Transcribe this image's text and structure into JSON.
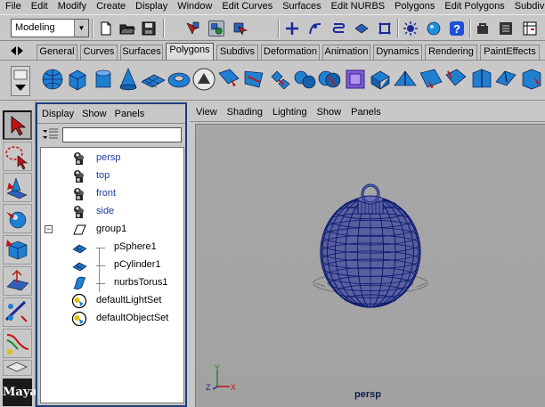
{
  "menubar": [
    "File",
    "Edit",
    "Modify",
    "Create",
    "Display",
    "Window",
    "Edit Curves",
    "Surfaces",
    "Edit NURBS",
    "Polygons",
    "Edit Polygons",
    "Subdiv Su"
  ],
  "status_line": {
    "menu_set": "Modeling",
    "icons": [
      "new-scene-icon",
      "open-scene-icon",
      "save-scene-icon",
      "select-hierarchy-icon",
      "select-object-icon",
      "select-component-icon",
      "snap-grid-icon",
      "snap-curve-icon",
      "snap-point-icon",
      "snap-view-plane-icon",
      "snap-live-icon",
      "history-icon",
      "render-icon",
      "ipr-icon",
      "render-globals-icon",
      "help-icon",
      "channel-box-icon"
    ]
  },
  "shelf_tabs": [
    "General",
    "Curves",
    "Surfaces",
    "Polygons",
    "Subdivs",
    "Deformation",
    "Animation",
    "Dynamics",
    "Rendering",
    "PaintEffects"
  ],
  "active_shelf_tab": "Polygons",
  "shelf_items": [
    "poly-sphere-icon",
    "poly-cube-icon",
    "poly-cylinder-icon",
    "poly-cone-icon",
    "poly-plane-icon",
    "poly-torus-icon",
    "create-polygon-tool-icon",
    "append-polygon-icon",
    "split-polygon-icon",
    "combine-icon",
    "separate-icon",
    "boolean-icon",
    "smooth-icon",
    "extrude-face-icon",
    "extrude-edge-icon",
    "merge-vertices-icon",
    "poly-reduce-icon",
    "wedge-icon",
    "bevel-icon",
    "subdivide-icon"
  ],
  "toolbox": [
    "select-tool-icon",
    "lasso-tool-icon",
    "move-tool-icon",
    "rotate-tool-icon",
    "scale-tool-icon",
    "universal-manipulator-icon",
    "soft-modification-icon",
    "show-manipulator-icon",
    "last-tool-icon"
  ],
  "outliner": {
    "menus": [
      "Display",
      "Show",
      "Panels"
    ],
    "filter_value": "",
    "items": [
      {
        "label": "persp",
        "icon": "camera-icon",
        "indent": 0,
        "color": "#1e3f9a"
      },
      {
        "label": "top",
        "icon": "camera-icon",
        "indent": 0,
        "color": "#1e3f9a"
      },
      {
        "label": "front",
        "icon": "camera-icon",
        "indent": 0,
        "color": "#1e3f9a"
      },
      {
        "label": "side",
        "icon": "camera-icon",
        "indent": 0,
        "color": "#1e3f9a"
      },
      {
        "label": "group1",
        "icon": "group-icon",
        "indent": 0,
        "color": "#000000",
        "expanded": true
      },
      {
        "label": "pSphere1",
        "icon": "mesh-icon",
        "indent": 1,
        "color": "#000000"
      },
      {
        "label": "pCylinder1",
        "icon": "mesh-icon",
        "indent": 1,
        "color": "#000000"
      },
      {
        "label": "nurbsTorus1",
        "icon": "nurbs-surface-icon",
        "indent": 1,
        "color": "#000000"
      },
      {
        "label": "defaultLightSet",
        "icon": "set-icon",
        "indent": 0,
        "color": "#000000"
      },
      {
        "label": "defaultObjectSet",
        "icon": "set-icon",
        "indent": 0,
        "color": "#000000"
      }
    ],
    "expander_symbol": "−"
  },
  "viewport": {
    "menus": [
      "View",
      "Shading",
      "Lighting",
      "Show",
      "Panels"
    ],
    "camera_label": "persp",
    "axis_labels": {
      "x": "X",
      "y": "Y",
      "z": "Z"
    }
  },
  "logo_text": "Maya",
  "colors": {
    "ui_gray": "#c8c8c8",
    "outliner_border": "#1e3f7a",
    "viewport_bg": "#a5a5a5",
    "wire": "#0b1a6e",
    "mesh_fill": "#5a5fa0"
  }
}
